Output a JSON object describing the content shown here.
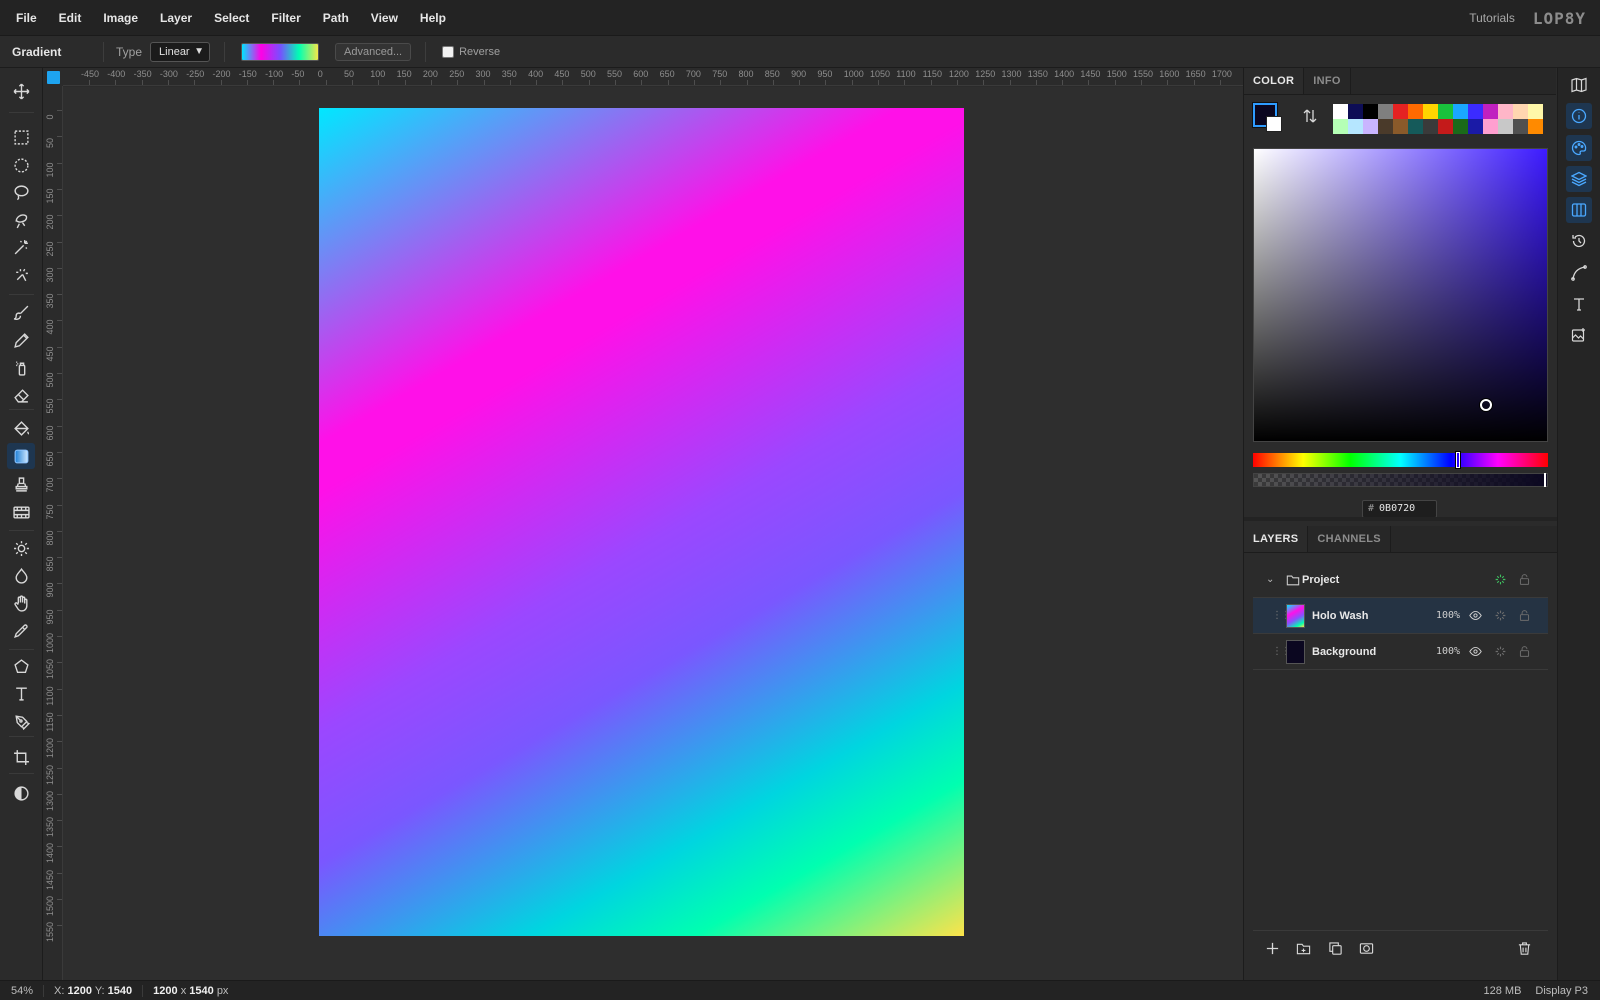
{
  "menu": [
    "File",
    "Edit",
    "Image",
    "Layer",
    "Select",
    "Filter",
    "Path",
    "View",
    "Help"
  ],
  "header": {
    "tutorials": "Tutorials",
    "logo": "LOP8Y"
  },
  "options": {
    "tool_name": "Gradient",
    "type_label": "Type",
    "type_value": "Linear",
    "advanced_label": "Advanced...",
    "reverse_label": "Reverse",
    "reverse_checked": false
  },
  "rulers": {
    "top": [
      "-450",
      "-400",
      "-350",
      "-300",
      "-250",
      "-200",
      "-150",
      "-100",
      "-50",
      "0",
      "50",
      "100",
      "150",
      "200",
      "250",
      "300",
      "350",
      "400",
      "450",
      "500",
      "550",
      "600",
      "650",
      "700",
      "750",
      "800",
      "850",
      "900",
      "950",
      "1000",
      "1050",
      "1100",
      "1150",
      "1200",
      "1250",
      "1300",
      "1350",
      "1400",
      "1450",
      "1500",
      "1550",
      "1600",
      "1650",
      "1700"
    ],
    "left": [
      "0",
      "50",
      "100",
      "150",
      "200",
      "250",
      "300",
      "350",
      "400",
      "450",
      "500",
      "550",
      "600",
      "650",
      "700",
      "750",
      "800",
      "850",
      "900",
      "950",
      "1000",
      "1050",
      "1100",
      "1150",
      "1200",
      "1250",
      "1300",
      "1350",
      "1400",
      "1450",
      "1500",
      "1550"
    ]
  },
  "color_panel": {
    "tabs": [
      "COLOR",
      "INFO"
    ],
    "active_tab": "COLOR",
    "foreground": "#0b0720",
    "background": "#ffffff",
    "hex_value": "0B0720",
    "palette": [
      "#ffffff",
      "#0d0d55",
      "#000000",
      "#7f7f7f",
      "#e52222",
      "#ff6a00",
      "#ffd500",
      "#19c23c",
      "#1aa7ff",
      "#3b2bff",
      "#c020c0",
      "#ffb6c8",
      "#ffd6b0",
      "#fff7a8",
      "#b5ffb5",
      "#b5e6ff",
      "#c9b5ff",
      "#4a3a2a",
      "#8a5a2a",
      "#155a5a",
      "#3a3a3a",
      "#c41a1a",
      "#1a6a1a",
      "#1a1aa6",
      "#ff9fd0",
      "#c8c8c8",
      "#505050",
      "#ff8a00"
    ]
  },
  "layers_panel": {
    "tabs": [
      "LAYERS",
      "CHANNELS"
    ],
    "active_tab": "LAYERS",
    "group": {
      "name": "Project"
    },
    "layers": [
      {
        "name": "Holo Wash",
        "opacity": "100%",
        "selected": true
      },
      {
        "name": "Background",
        "opacity": "100%",
        "selected": false
      }
    ]
  },
  "status": {
    "zoom": "54%",
    "x_label": "X:",
    "x_value": "1200",
    "y_label": "Y:",
    "y_value": "1540",
    "doc_w": "1200",
    "doc_x": "x",
    "doc_h": "1540",
    "doc_unit": "px",
    "memory": "128 MB",
    "color_profile": "Display P3"
  }
}
